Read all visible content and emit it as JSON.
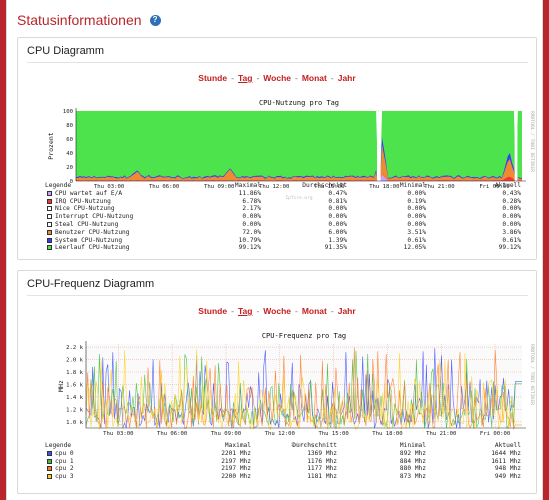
{
  "page": {
    "title": "Statusinformationen"
  },
  "cpu_panel": {
    "title": "CPU Diagramm",
    "ranges": [
      "Stunde",
      "Tag",
      "Woche",
      "Monat",
      "Jahr"
    ],
    "active_range": "Tag",
    "chart_title": "CPU-Nutzung pro Tag",
    "ylabel": "Prozent",
    "side_label": "RRDTOOL / TOBI OETIKER",
    "watermark": "Ipfire.org",
    "legend_headers": {
      "label": "Legende",
      "max": "Maximal",
      "avg": "Durchschnitt",
      "min": "Minimal",
      "cur": "Aktuell"
    },
    "legend_rows": [
      {
        "label": "CPU wartet auf E/A",
        "max": "11.86%",
        "avg": "0.47%",
        "min": "0.00%",
        "cur": "0.43%",
        "color": "#c8a0ff"
      },
      {
        "label": "IRQ CPU-Nutzung",
        "max": "6.78%",
        "avg": "0.81%",
        "min": "0.19%",
        "cur": "0.28%",
        "color": "#ff3030"
      },
      {
        "label": "Nice CPU-Nutzung",
        "max": "2.17%",
        "avg": "0.00%",
        "min": "0.00%",
        "cur": "0.00%",
        "color": "#ffffff"
      },
      {
        "label": "Interrupt CPU-Nutzung",
        "max": "0.00%",
        "avg": "0.00%",
        "min": "0.00%",
        "cur": "0.00%",
        "color": "#ffffff"
      },
      {
        "label": "Steal CPU-Nutzung",
        "max": "0.00%",
        "avg": "0.00%",
        "min": "0.00%",
        "cur": "0.00%",
        "color": "#ffffff"
      },
      {
        "label": "Benutzer CPU-Nutzung",
        "max": "72.0%",
        "avg": "6.00%",
        "min": "3.51%",
        "cur": "3.86%",
        "color": "#f08a30"
      },
      {
        "label": "System CPU-Nutzung",
        "max": "10.79%",
        "avg": "1.39%",
        "min": "0.61%",
        "cur": "0.61%",
        "color": "#3a3aff"
      },
      {
        "label": "Leerlauf CPU-Nutzung",
        "max": "99.12%",
        "avg": "91.35%",
        "min": "12.05%",
        "cur": "99.12%",
        "color": "#4ce34c"
      }
    ]
  },
  "freq_panel": {
    "title": "CPU-Frequenz Diagramm",
    "ranges": [
      "Stunde",
      "Tag",
      "Woche",
      "Monat",
      "Jahr"
    ],
    "active_range": "Tag",
    "chart_title": "CPU-Frequenz pro Tag",
    "ylabel": "MHz",
    "side_label": "RRDTOOL / TOBI OETIKER",
    "watermark": "Ipfire.org",
    "legend_headers": {
      "label": "Legende",
      "max": "Maximal",
      "avg": "Durchschnitt",
      "min": "Minimal",
      "cur": "Aktuell"
    },
    "legend_rows": [
      {
        "label": "cpu 0",
        "max": "2201 Mhz",
        "avg": "1369 Mhz",
        "min": "892 Mhz",
        "cur": "1644 Mhz",
        "color": "#4050ff"
      },
      {
        "label": "cpu 1",
        "max": "2197 Mhz",
        "avg": "1176 Mhz",
        "min": "884 Mhz",
        "cur": "1611 Mhz",
        "color": "#40c040"
      },
      {
        "label": "cpu 2",
        "max": "2197 Mhz",
        "avg": "1177 Mhz",
        "min": "880 Mhz",
        "cur": "948 Mhz",
        "color": "#ff7a20"
      },
      {
        "label": "cpu 3",
        "max": "2200 Mhz",
        "avg": "1181 Mhz",
        "min": "873 Mhz",
        "cur": "949 Mhz",
        "color": "#ffd020"
      }
    ]
  },
  "chart_data": [
    {
      "type": "area",
      "title": "CPU-Nutzung pro Tag",
      "xlabel": "",
      "ylabel": "Prozent",
      "x_ticks": [
        "Thu 03:00",
        "Thu 06:00",
        "Thu 09:00",
        "Thu 12:00",
        "Thu 15:00",
        "Thu 18:00",
        "Thu 21:00",
        "Fri 00:00"
      ],
      "y_ticks": [
        0,
        20,
        40,
        60,
        80,
        100
      ],
      "ylim": [
        0,
        100
      ],
      "x_range_hours": [
        1.2,
        25.5
      ],
      "gaps_hours": [
        [
          17.6,
          17.8
        ],
        [
          25.1,
          25.25
        ]
      ],
      "stack_order": [
        "CPU wartet auf E/A",
        "IRQ CPU-Nutzung",
        "Benutzer CPU-Nutzung",
        "System CPU-Nutzung",
        "Leerlauf CPU-Nutzung"
      ],
      "series": [
        {
          "name": "Benutzer CPU-Nutzung",
          "color": "#f08a30",
          "baseline": 4,
          "spikes": [
            [
              9.6,
              12
            ],
            [
              17.85,
              40
            ],
            [
              24.8,
              25
            ],
            [
              4.5,
              10
            ]
          ]
        },
        {
          "name": "System CPU-Nutzung",
          "color": "#3a3aff",
          "baseline": 1.4,
          "spikes": [
            [
              17.85,
              10
            ],
            [
              24.8,
              8
            ]
          ]
        },
        {
          "name": "IRQ CPU-Nutzung",
          "color": "#ff3030",
          "baseline": 0.5,
          "spikes": [
            [
              24.8,
              6
            ]
          ]
        },
        {
          "name": "CPU wartet auf E/A",
          "color": "#c8a0ff",
          "baseline": 0.4,
          "spikes": [
            [
              17.85,
              10
            ]
          ]
        },
        {
          "name": "Leerlauf CPU-Nutzung",
          "color": "#4ce34c",
          "fill_to": 100
        }
      ]
    },
    {
      "type": "line",
      "title": "CPU-Frequenz pro Tag",
      "xlabel": "",
      "ylabel": "MHz",
      "x_ticks": [
        "Thu 03:00",
        "Thu 06:00",
        "Thu 09:00",
        "Thu 12:00",
        "Thu 15:00",
        "Thu 18:00",
        "Thu 21:00",
        "Fri 00:00"
      ],
      "y_ticks": [
        "1.0 k",
        "1.2 k",
        "1.4 k",
        "1.6 k",
        "1.8 k",
        "2.0 k",
        "2.2 k"
      ],
      "ylim": [
        900,
        2250
      ],
      "x_range_hours": [
        1.2,
        25.5
      ],
      "series": [
        {
          "name": "cpu 0",
          "color": "#4050ff",
          "min": 892,
          "max": 2201,
          "last": 1644
        },
        {
          "name": "cpu 1",
          "color": "#40c040",
          "min": 884,
          "max": 2197,
          "last": 1611
        },
        {
          "name": "cpu 2",
          "color": "#ff7a20",
          "min": 880,
          "max": 2197,
          "last": 948
        },
        {
          "name": "cpu 3",
          "color": "#ffd020",
          "min": 873,
          "max": 2200,
          "last": 949
        }
      ]
    }
  ]
}
